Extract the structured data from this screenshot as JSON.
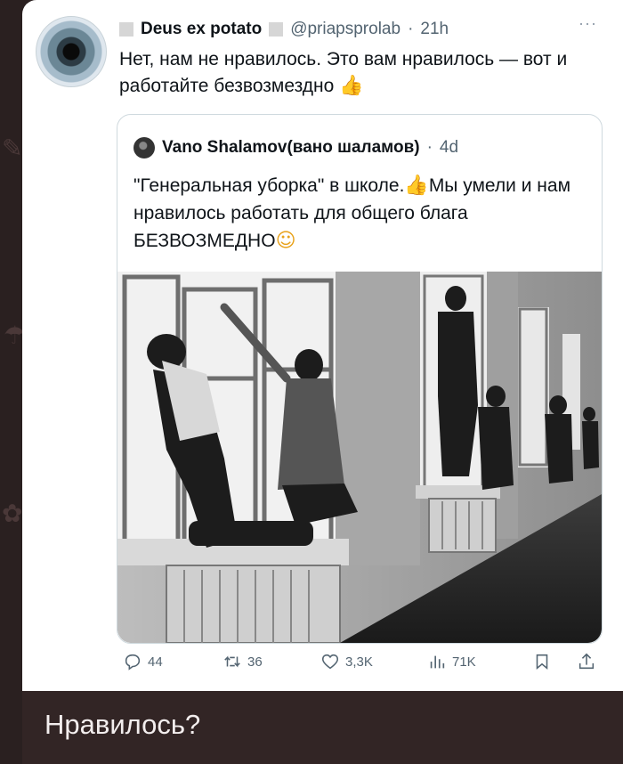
{
  "tweet": {
    "author_name": "Deus ex potato",
    "handle": "@priapsprolab",
    "separator": "·",
    "time": "21h",
    "more_label": "···",
    "text": "Нет, нам не нравилось. Это вам нравилось — вот и работайте безвозмездно",
    "text_emoji": "thumbs-up"
  },
  "quoted": {
    "author_name": "Vano Shalamov(вано шаламов)",
    "separator": "·",
    "time": "4d",
    "text_part1": "\"Генеральная уборка\" в школе.",
    "text_part2": "Мы умели и нам нравилось работать для общего блага БЕЗВОЗМЕДНО",
    "emoji_1": "thumbs-up",
    "emoji_2": "smiling-face-with-hearts",
    "photo": "black-and-white photo of schoolchildren washing classroom windows from the windowsills"
  },
  "actions": {
    "replies": "44",
    "reposts": "36",
    "likes": "3,3K",
    "views": "71K"
  },
  "caption": "Нравилось?",
  "colors": {
    "background": "#2a2020",
    "card": "#ffffff",
    "text": "#0f1419",
    "secondary": "#536471",
    "bar": "#322525"
  }
}
